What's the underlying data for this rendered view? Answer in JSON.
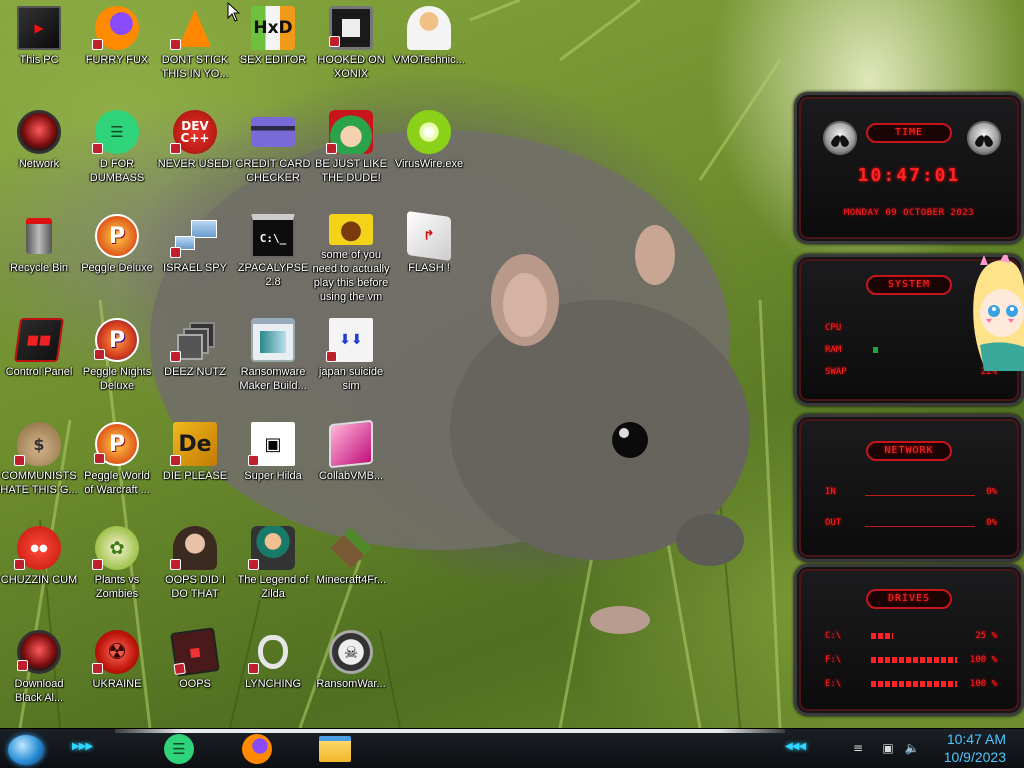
{
  "desktop": {
    "icons": [
      {
        "label": "This PC",
        "icon": "monitor-icon"
      },
      {
        "label": "FURRY FUX",
        "icon": "firefox-icon"
      },
      {
        "label": "DONT STICK THIS IN YO...",
        "icon": "vlc-cone-icon"
      },
      {
        "label": "SEX EDITOR",
        "icon": "hxd-editor-icon"
      },
      {
        "label": "HOOKED ON XONIX",
        "icon": "xonix-game-icon"
      },
      {
        "label": "VMOTechnic...",
        "icon": "doctor-avatar-icon"
      },
      {
        "label": "Network",
        "icon": "alien-orb-icon"
      },
      {
        "label": "D FOR DUMBASS",
        "icon": "green-chat-icon"
      },
      {
        "label": "NEVER USED!",
        "icon": "dev-cpp-icon"
      },
      {
        "label": "CREDIT CARD CHECKER",
        "icon": "credit-card-icon"
      },
      {
        "label": "BE JUST LIKE THE DUDE!",
        "icon": "elf-santa-icon"
      },
      {
        "label": "VirusWire.exe",
        "icon": "lime-icon"
      },
      {
        "label": "Recycle Bin",
        "icon": "recycle-bin-icon"
      },
      {
        "label": "Peggle Deluxe",
        "icon": "peggle-icon"
      },
      {
        "label": "ISRAEL SPY",
        "icon": "network-computers-icon"
      },
      {
        "label": "ZPACALYPSE 2.8",
        "icon": "terminal-icon"
      },
      {
        "label": "some of you need to actually play this before using the vm",
        "icon": "dog-game-icon"
      },
      {
        "label": "FLASH !",
        "icon": "flash-card-icon"
      },
      {
        "label": "Control Panel",
        "icon": "control-panel-icon"
      },
      {
        "label": "Peggle Nights Deluxe",
        "icon": "peggle-nights-icon"
      },
      {
        "label": "DEEZ NUTZ",
        "icon": "stacked-windows-icon"
      },
      {
        "label": "Ransomware Maker Build...",
        "icon": "window-app-icon"
      },
      {
        "label": "japan suicide sim",
        "icon": "japan-sim-icon"
      },
      {
        "label": "COMMUNISTS HATE THIS G...",
        "icon": "money-bag-icon"
      },
      {
        "label": "Peggle World of Warcraft ...",
        "icon": "peggle-wow-icon"
      },
      {
        "label": "DIE PLEASE",
        "icon": "de-icon"
      },
      {
        "label": "Super Hilda",
        "icon": "pixel-cat-icon"
      },
      {
        "label": "CollabVMB...",
        "icon": "collabvm-icon"
      },
      {
        "label": "CHUZZIN CUM",
        "icon": "chuzzle-icon"
      },
      {
        "label": "Plants vs Zombies",
        "icon": "plants-vs-zombies-icon"
      },
      {
        "label": "OOPS DID I DO THAT",
        "icon": "portrait-icon"
      },
      {
        "label": "The Legend of Zilda",
        "icon": "pixel-hero-icon"
      },
      {
        "label": "Minecraft4Fr...",
        "icon": "minecraft-block-icon"
      },
      {
        "label": "Download Black Al...",
        "icon": "alien-orb-icon"
      },
      {
        "label": "UKRAINE",
        "icon": "radiation-icon"
      },
      {
        "label": "OOPS",
        "icon": "oops-card-icon"
      },
      {
        "label": "LYNCHING",
        "icon": "rope-icon"
      },
      {
        "label": "RansomWar...",
        "icon": "skull-icon"
      }
    ]
  },
  "widgets": {
    "time": {
      "title": "TIME",
      "clock": "10:47:01",
      "date": "MONDAY 09 OCTOBER 2023"
    },
    "system": {
      "title": "SYSTEM",
      "rows": [
        {
          "label": "CPU",
          "value": "",
          "fill": 0
        },
        {
          "label": "RAM",
          "value": "",
          "fill": 0.06
        },
        {
          "label": "SWAP",
          "value": "22%",
          "fill": 0
        }
      ]
    },
    "network": {
      "title": "NETWORK",
      "rows": [
        {
          "label": "IN",
          "value": "0%"
        },
        {
          "label": "OUT",
          "value": "0%"
        }
      ]
    },
    "drives": {
      "title": "DRIVES",
      "rows": [
        {
          "label": "C:\\",
          "value": "25 %",
          "fill": 0.25
        },
        {
          "label": "F:\\",
          "value": "100 %",
          "fill": 1.0
        },
        {
          "label": "E:\\",
          "value": "100 %",
          "fill": 1.0
        }
      ]
    }
  },
  "taskbar": {
    "pinned": [
      {
        "name": "chat-app",
        "icon": "green-chat-icon"
      },
      {
        "name": "firefox",
        "icon": "firefox-icon"
      },
      {
        "name": "file-explorer",
        "icon": "folder-icon"
      }
    ],
    "clock_time": "10:47 AM",
    "clock_date": "10/9/2023",
    "accent": "#2fd6ff"
  }
}
